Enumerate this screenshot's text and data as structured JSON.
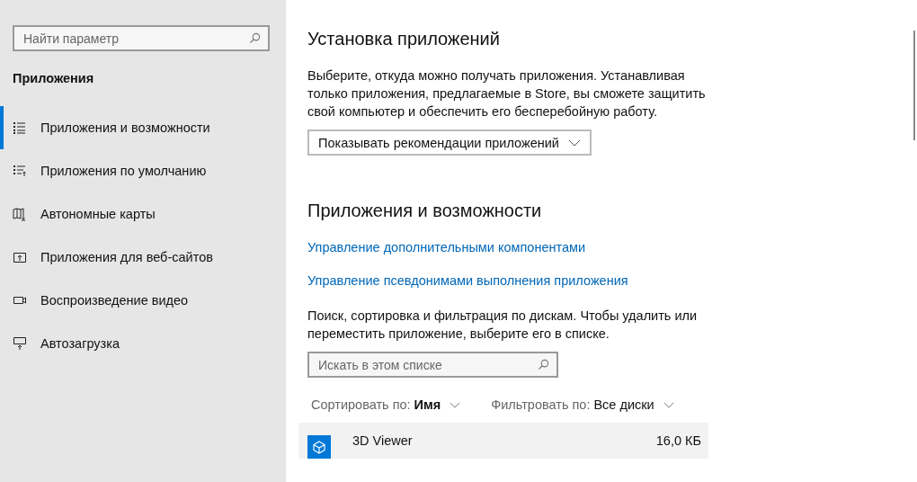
{
  "sidebar": {
    "search": {
      "placeholder": "Найти параметр"
    },
    "section_title": "Приложения",
    "items": [
      {
        "label": "Приложения и возможности",
        "kind": "list",
        "selected": true
      },
      {
        "label": "Приложения по умолчанию",
        "kind": "defaults",
        "selected": false
      },
      {
        "label": "Автономные карты",
        "kind": "map",
        "selected": false
      },
      {
        "label": "Приложения для веб-сайтов",
        "kind": "web",
        "selected": false
      },
      {
        "label": "Воспроизведение видео",
        "kind": "video",
        "selected": false
      },
      {
        "label": "Автозагрузка",
        "kind": "startup",
        "selected": false
      }
    ]
  },
  "main": {
    "install": {
      "heading": "Установка приложений",
      "description": "Выберите, откуда можно получать приложения. Устанавливая только приложения, предлагаемые в Store, вы сможете защитить свой компьютер и обеспечить его бесперебойную работу.",
      "dropdown": "Показывать рекомендации приложений"
    },
    "apps": {
      "heading": "Приложения и возможности",
      "links": [
        "Управление дополнительными компонентами",
        "Управление псевдонимами выполнения приложения"
      ],
      "description": "Поиск, сортировка и фильтрация по дискам. Чтобы удалить или переместить приложение, выберите его в списке.",
      "search": {
        "placeholder": "Искать в этом списке"
      },
      "sort": {
        "label": "Сортировать по:",
        "value": "Имя"
      },
      "filter": {
        "label": "Фильтровать по:",
        "value": "Все диски"
      },
      "list": [
        {
          "name": "3D Viewer",
          "size": "16,0 КБ",
          "selected": true
        }
      ]
    }
  }
}
